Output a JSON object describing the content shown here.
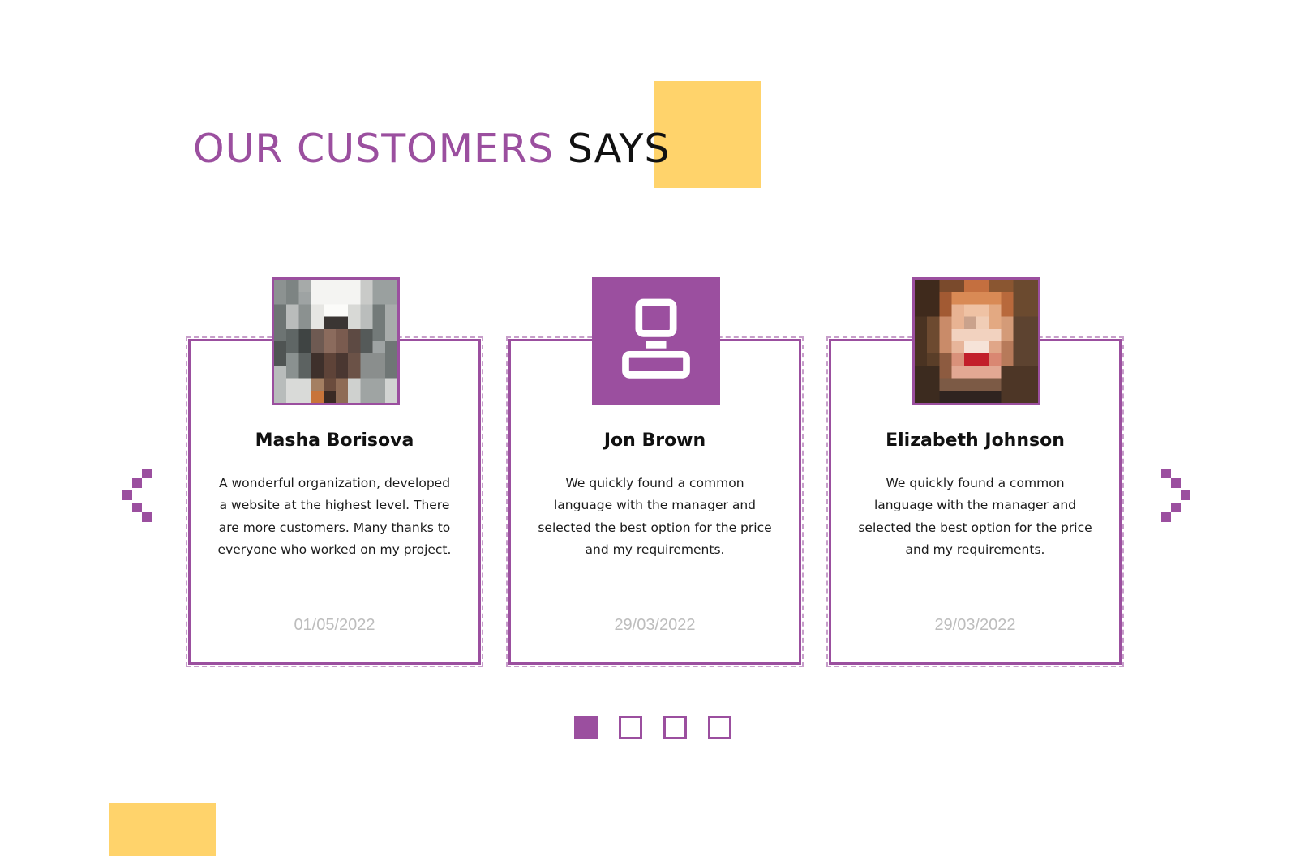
{
  "heading": {
    "accent": "OUR CUSTOMERS",
    "rest": "SAYS"
  },
  "colors": {
    "accent": "#9B4F9F",
    "highlight": "#FFD36B",
    "date": "#BDBDBD"
  },
  "testimonials": [
    {
      "avatar": "pixelated-photo",
      "name": "Masha Borisova",
      "text": "A wonderful organization, developed a website at the highest level. There are more customers. Many thanks to everyone who worked on my project.",
      "date": "01/05/2022"
    },
    {
      "avatar": "user-icon",
      "name": "Jon Brown",
      "text": "We quickly found a common language with the manager and selected the best option for the price and my requirements.",
      "date": "29/03/2022"
    },
    {
      "avatar": "pixelated-photo",
      "name": "Elizabeth Johnson",
      "text": "We quickly found a common language with the manager and selected the best option for the price and my requirements.",
      "date": "29/03/2022"
    }
  ],
  "navigation": {
    "prev_icon": "chevron-left-icon",
    "next_icon": "chevron-right-icon"
  },
  "pagination": {
    "total": 4,
    "active": 1
  }
}
